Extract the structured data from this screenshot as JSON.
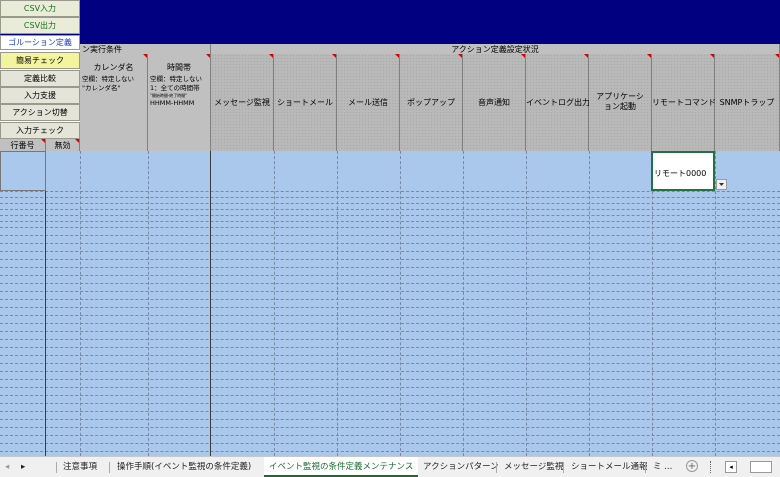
{
  "sidebar_buttons": [
    "CSV入力",
    "CSV出力",
    "ゴルーション定義",
    "簡易チェック",
    "定義比較",
    "入力支援",
    "アクション切替",
    "入力チェック"
  ],
  "section_headers": {
    "exec_conditions": "ン実行条件",
    "action_settings": "アクション定義設定状況"
  },
  "columns": {
    "calendar": {
      "title": "カレンダ名",
      "desc": [
        "空欄：特定しない",
        "\"カレンダ名\""
      ]
    },
    "timezone": {
      "title": "時間帯",
      "desc": [
        "空欄：特定しない",
        "1：全ての時間帯",
        "\"開始時間-終了時間\"",
        "HHMM-HHMM"
      ]
    },
    "row_no": "行番号",
    "disabled": "無効",
    "actions": [
      "メッセージ監視",
      "ショートメール",
      "メール送信",
      "ポップアップ",
      "音声通知",
      "イベントログ出力",
      "アプリケーション起動",
      "リモートコマンド",
      "SNMPトラップ"
    ]
  },
  "grid": {
    "selected_cell_value": "リモート0000",
    "dropdown_icon": "chevron-down-icon"
  },
  "sheet_tabs": [
    "注意事項",
    "操作手順(イベント監視の条件定義)",
    "イベント監視の条件定義メンテナンス",
    "アクションパターン",
    "メッセージ監視",
    "ショートメール通報",
    "ミ ..."
  ],
  "active_tab": "イベント監視の条件定義メンテナンス",
  "nav": {
    "prev_icon": "arrow-left-icon",
    "next_icon": "arrow-right-icon",
    "add_icon": "add-sheet-icon"
  },
  "colors": {
    "top_bar": "#000080",
    "grid_fill": "#a9c8ec",
    "active_tab": "#1d6b2f",
    "comment_marker": "#d80000"
  }
}
